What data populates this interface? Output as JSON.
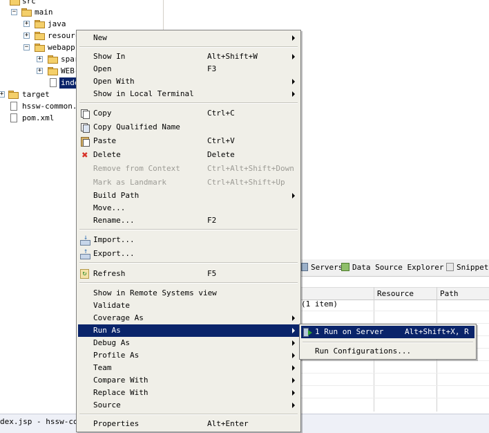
{
  "tree": {
    "items": [
      {
        "label": "src"
      },
      {
        "label": "main"
      },
      {
        "label": "java"
      },
      {
        "label": "resourc"
      },
      {
        "label": "webapp"
      },
      {
        "label": "spar"
      },
      {
        "label": "WEB-"
      },
      {
        "label": "inde"
      },
      {
        "label": "target"
      },
      {
        "label": "hssw-common.i"
      },
      {
        "label": "pom.xml"
      }
    ]
  },
  "status": {
    "text": "dex.jsp - hssw-com"
  },
  "views": {
    "tabs": [
      {
        "label": "Servers"
      },
      {
        "label": "Data Source Explorer"
      },
      {
        "label": "Snippets"
      }
    ],
    "columns": [
      "Resource",
      "Path"
    ],
    "summary": "(1 item)"
  },
  "context_menu": {
    "items": [
      {
        "label": "New",
        "accel": "",
        "submenu": true
      },
      {
        "label": "Show In",
        "accel": "Alt+Shift+W",
        "submenu": true
      },
      {
        "label": "Open",
        "accel": "F3"
      },
      {
        "label": "Open With",
        "accel": "",
        "submenu": true
      },
      {
        "label": "Show in Local Terminal",
        "accel": "",
        "submenu": true
      },
      {
        "label": "Copy",
        "accel": "Ctrl+C"
      },
      {
        "label": "Copy Qualified Name",
        "accel": ""
      },
      {
        "label": "Paste",
        "accel": "Ctrl+V"
      },
      {
        "label": "Delete",
        "accel": "Delete"
      },
      {
        "label": "Remove from Context",
        "accel": "Ctrl+Alt+Shift+Down",
        "disabled": true
      },
      {
        "label": "Mark as Landmark",
        "accel": "Ctrl+Alt+Shift+Up",
        "disabled": true
      },
      {
        "label": "Build Path",
        "accel": "",
        "submenu": true
      },
      {
        "label": "Move...",
        "accel": ""
      },
      {
        "label": "Rename...",
        "accel": "F2"
      },
      {
        "label": "Import...",
        "accel": ""
      },
      {
        "label": "Export...",
        "accel": ""
      },
      {
        "label": "Refresh",
        "accel": "F5"
      },
      {
        "label": "Show in Remote Systems view",
        "accel": ""
      },
      {
        "label": "Validate",
        "accel": ""
      },
      {
        "label": "Coverage As",
        "accel": "",
        "submenu": true
      },
      {
        "label": "Run As",
        "accel": "",
        "submenu": true,
        "highlighted": true
      },
      {
        "label": "Debug As",
        "accel": "",
        "submenu": true
      },
      {
        "label": "Profile As",
        "accel": "",
        "submenu": true
      },
      {
        "label": "Team",
        "accel": "",
        "submenu": true
      },
      {
        "label": "Compare With",
        "accel": "",
        "submenu": true
      },
      {
        "label": "Replace With",
        "accel": "",
        "submenu": true
      },
      {
        "label": "Source",
        "accel": "",
        "submenu": true
      },
      {
        "label": "Properties",
        "accel": "Alt+Enter"
      }
    ]
  },
  "run_as_submenu": {
    "items": [
      {
        "label": "1 Run on Server",
        "accel": "Alt+Shift+X, R",
        "highlighted": true
      },
      {
        "label": "Run Configurations...",
        "accel": ""
      }
    ]
  },
  "colors": {
    "selection": "#0a246a",
    "menu_bg": "#f0efe8",
    "disabled_text": "#9c9b95"
  }
}
